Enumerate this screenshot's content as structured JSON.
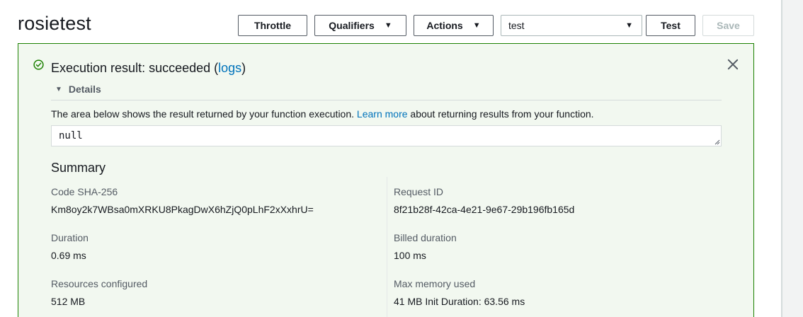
{
  "header": {
    "title": "rosietest",
    "throttle_label": "Throttle",
    "qualifiers_label": "Qualifiers",
    "actions_label": "Actions",
    "test_event_selected": "test",
    "test_label": "Test",
    "save_label": "Save"
  },
  "result": {
    "heading_prefix": "Execution result: succeeded (",
    "logs_link": "logs",
    "heading_suffix": ")",
    "details_label": "Details",
    "desc_prefix": "The area below shows the result returned by your function execution.",
    "learn_more_link": "Learn more",
    "desc_suffix": "about returning results from your function.",
    "output_value": "null",
    "status_color": "#1d8102"
  },
  "summary": {
    "title": "Summary",
    "code_sha_label": "Code SHA-256",
    "code_sha_value": "Km8oy2k7WBsa0mXRKU8PkagDwX6hZjQ0pLhF2xXxhrU=",
    "request_id_label": "Request ID",
    "request_id_value": "8f21b28f-42ca-4e21-9e67-29b196fb165d",
    "duration_label": "Duration",
    "duration_value": "0.69 ms",
    "billed_duration_label": "Billed duration",
    "billed_duration_value": "100 ms",
    "resources_label": "Resources configured",
    "resources_value": "512 MB",
    "max_memory_label": "Max memory used",
    "max_memory_value": "41 MB Init Duration: 63.56 ms"
  },
  "icons": {
    "success": "check-circle-icon",
    "close": "close-icon",
    "expand": "caret-down-icon",
    "dropdown": "caret-down-icon"
  }
}
